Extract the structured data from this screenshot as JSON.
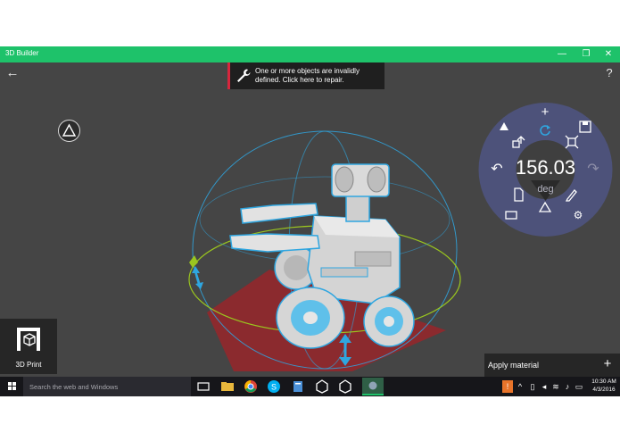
{
  "window": {
    "title": "3D Builder",
    "minimize_glyph": "—",
    "restore_glyph": "❐",
    "close_glyph": "✕"
  },
  "toolbar": {
    "back_glyph": "←",
    "help_glyph": "?"
  },
  "notification": {
    "message": "One or more objects are invalidly defined. Click here to repair.",
    "icon": "wrench-icon",
    "accent_color": "#d7263d"
  },
  "dial": {
    "value": "156.03",
    "unit": "deg",
    "plus_glyph": "+",
    "undo_glyph": "↶",
    "redo_glyph": "↷",
    "icons": [
      "rotate-icon",
      "move-icon",
      "scale-icon",
      "save-icon",
      "paint-icon",
      "edit-icon",
      "document-icon",
      "rectangle-icon",
      "triangle-icon",
      "settings-icon"
    ],
    "ring_color": "#4d527a"
  },
  "left_panel": {
    "print_label": "3D Print"
  },
  "bottom_panel": {
    "apply_material_label": "Apply material",
    "add_glyph": "+"
  },
  "taskbar": {
    "search_placeholder": "Search the web and Windows",
    "apps": [
      "task-view",
      "file-explorer",
      "chrome",
      "skype",
      "files",
      "unity",
      "unity",
      "media",
      "3d-builder"
    ],
    "tray": [
      "notification-badge",
      "chevron-up",
      "network",
      "volume",
      "wifi",
      "message"
    ],
    "clock_time": "10:30 AM",
    "clock_date": "4/3/2016"
  },
  "colors": {
    "accent": "#1ec26a",
    "viewport": "#454545",
    "selection": "#2fa6e0",
    "floor": "#8b2a2e"
  }
}
